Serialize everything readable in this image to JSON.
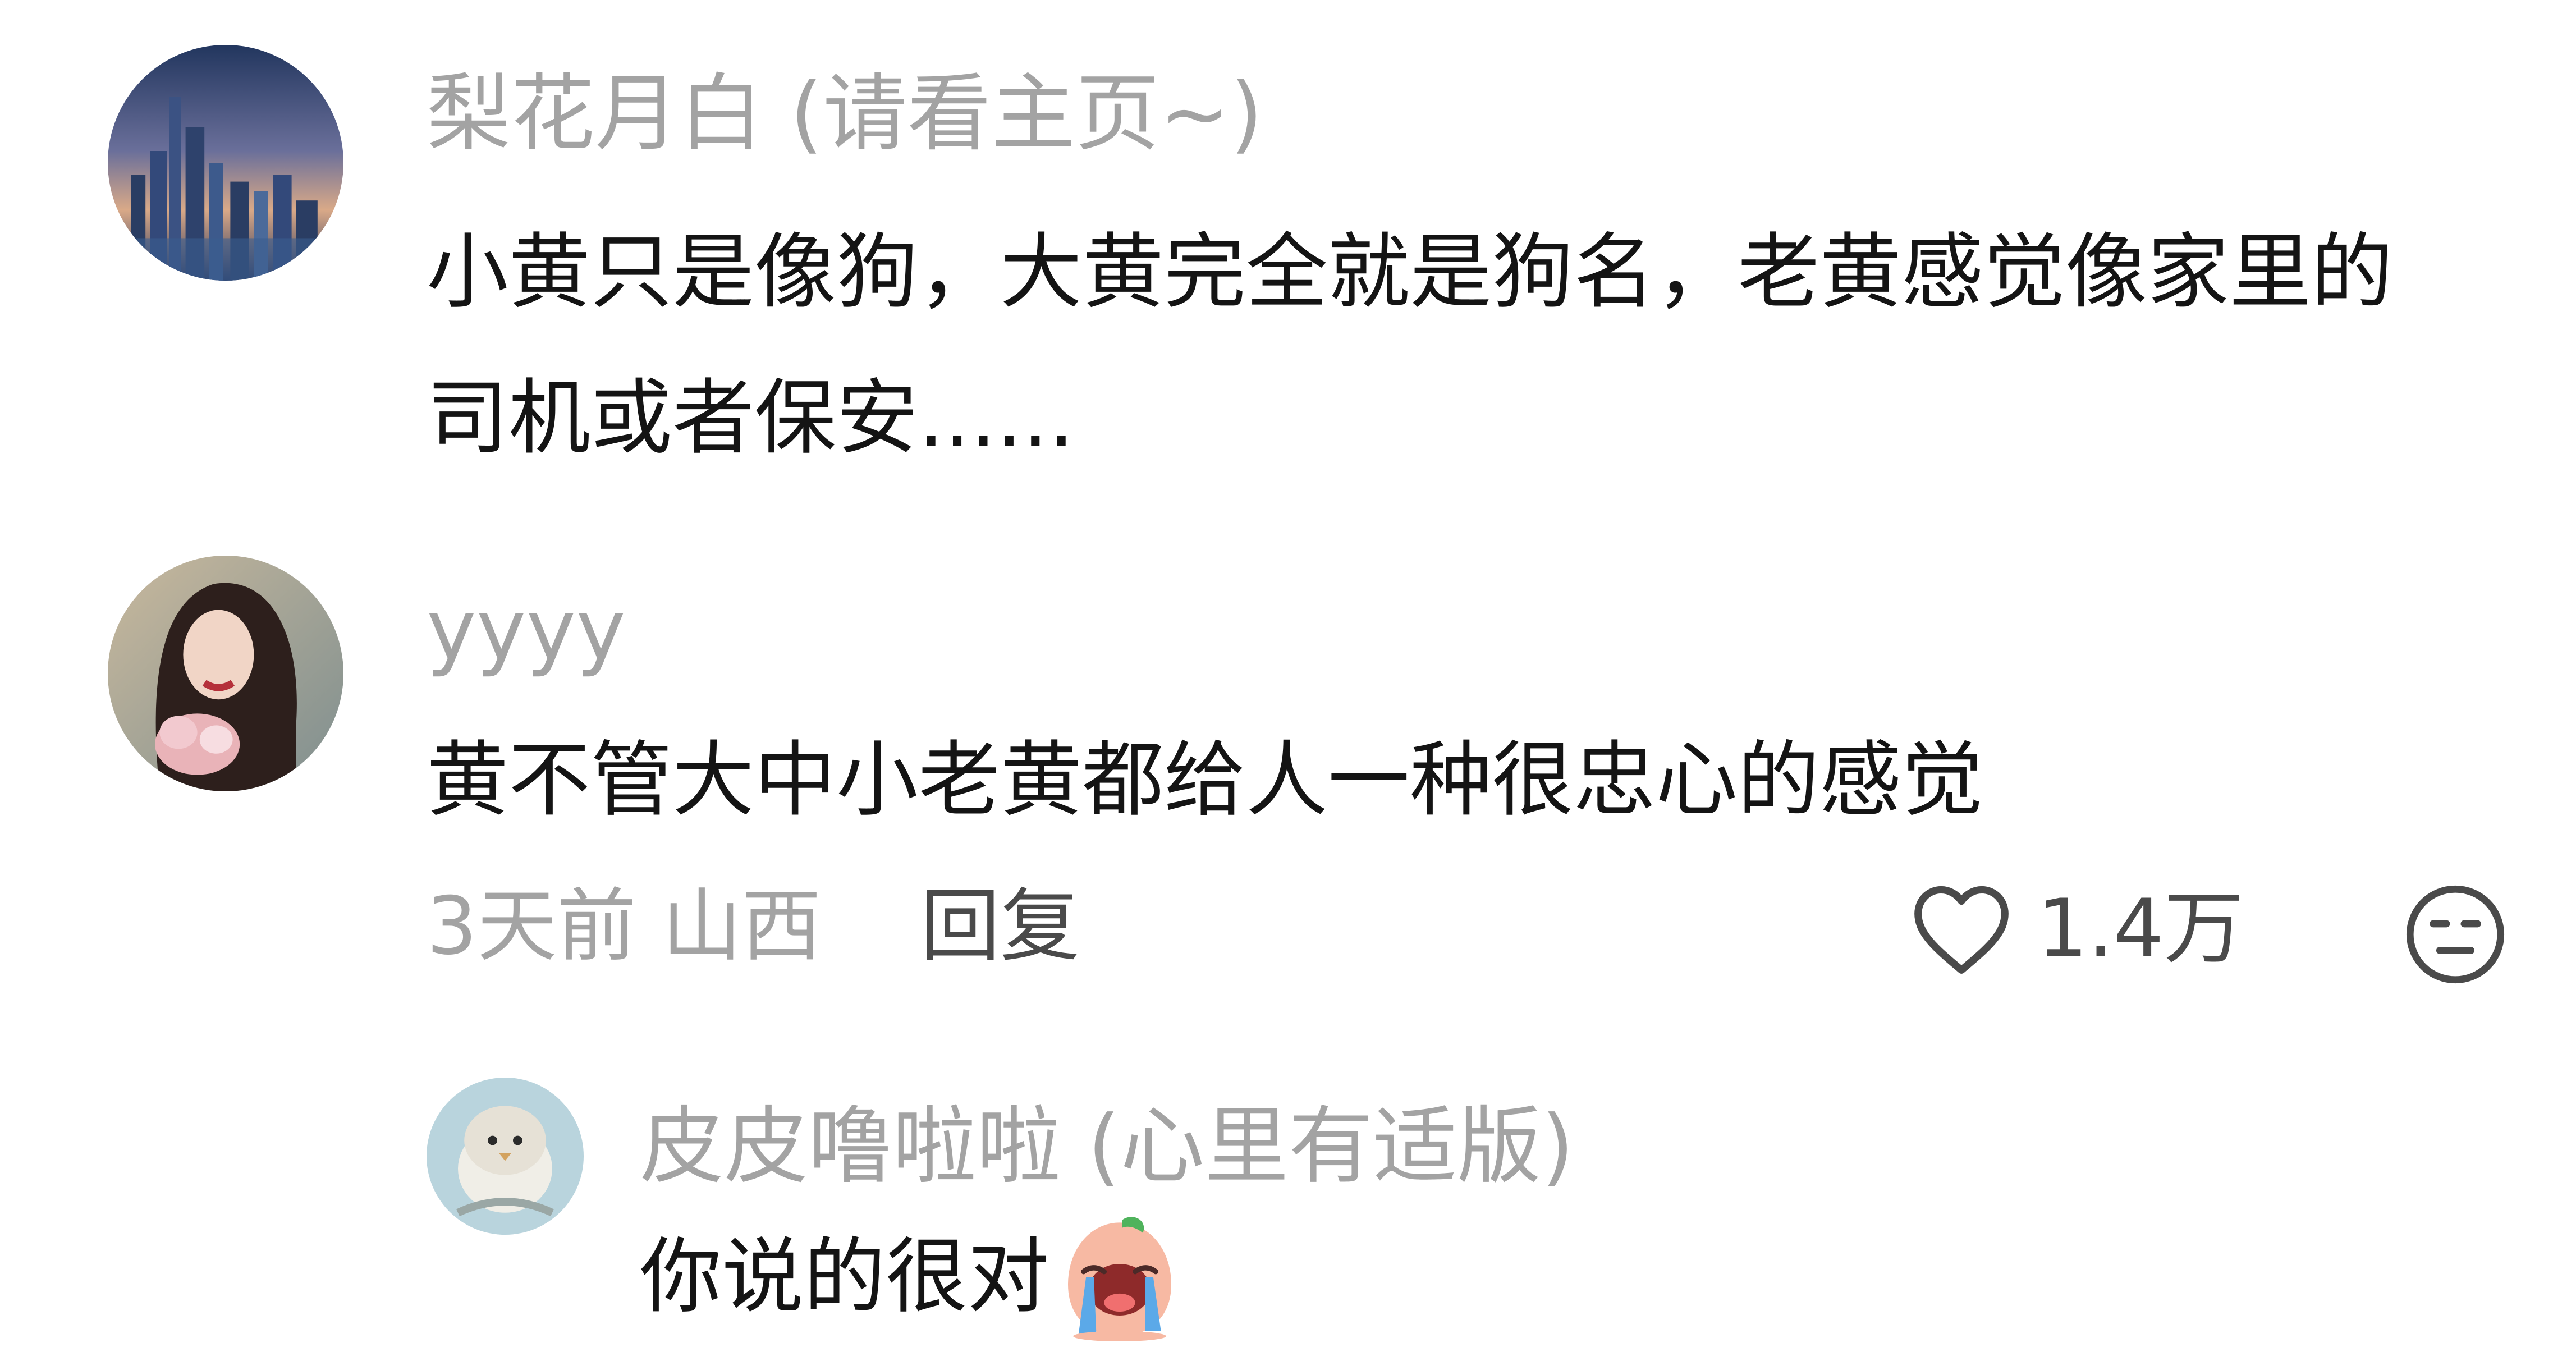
{
  "comments": [
    {
      "avatar_icon": "city-skyline-avatar",
      "username": "梨花月白 (请看主页~)",
      "text": "小黄只是像狗，大黄完全就是狗名，老黄感觉像家里的司机或者保安......"
    },
    {
      "avatar_icon": "portrait-avatar",
      "username": "yyyy",
      "text": "黄不管大中小老黄都给人一种很忠心的感觉",
      "time_location": "3天前 山西",
      "reply_label": "回复",
      "like_icon": "heart-outline-icon",
      "like_count": "1.4万",
      "dislike_icon": "unamused-face-icon"
    }
  ],
  "reply": {
    "avatar_icon": "bird-avatar",
    "username": "皮皮噜啦啦 (心里有适版)",
    "text": "你说的很对",
    "emoji_icon": "crying-peach-emoji"
  }
}
